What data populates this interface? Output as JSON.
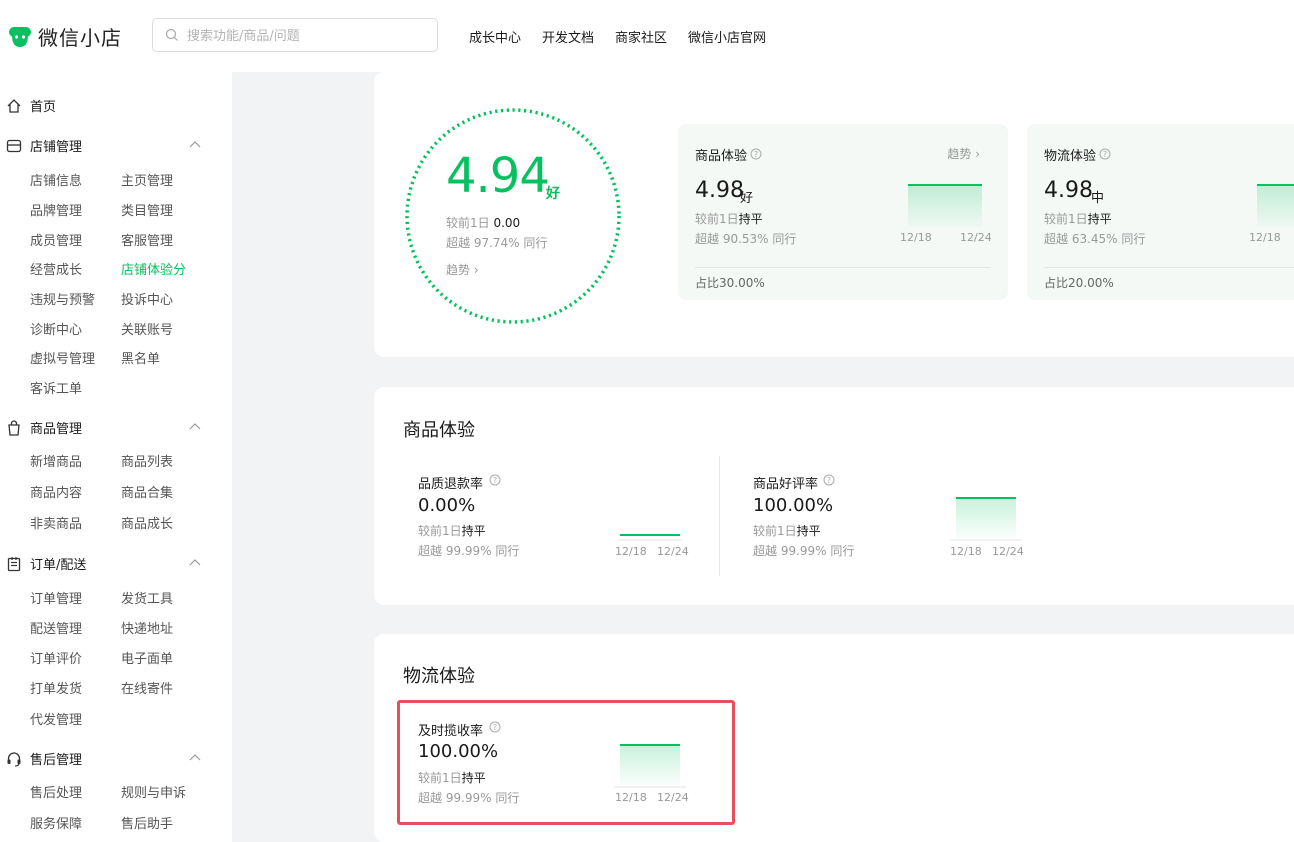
{
  "app": {
    "title": "微信小店"
  },
  "search": {
    "placeholder": "搜索功能/商品/问题"
  },
  "topnav": [
    "成长中心",
    "开发文档",
    "商家社区",
    "微信小店官网"
  ],
  "sidebar": {
    "home": "首页",
    "groups": [
      {
        "label": "店铺管理",
        "items": [
          "店铺信息",
          "主页管理",
          "品牌管理",
          "类目管理",
          "成员管理",
          "客服管理",
          "经营成长",
          "店铺体验分",
          "违规与预警",
          "投诉中心",
          "诊断中心",
          "关联账号",
          "虚拟号管理",
          "黑名单",
          "客诉工单"
        ],
        "active": "店铺体验分"
      },
      {
        "label": "商品管理",
        "items": [
          "新增商品",
          "商品列表",
          "商品内容",
          "商品合集",
          "非卖商品",
          "商品成长"
        ]
      },
      {
        "label": "订单/配送",
        "items": [
          "订单管理",
          "发货工具",
          "配送管理",
          "快递地址",
          "订单评价",
          "电子面单",
          "打单发货",
          "在线寄件",
          "代发管理"
        ]
      },
      {
        "label": "售后管理",
        "items": [
          "售后处理",
          "规则与申诉",
          "服务保障",
          "售后助手"
        ]
      }
    ]
  },
  "overview": {
    "score": "4.94",
    "grade": "好",
    "compare_prefix": "较前1日",
    "compare_value": "0.00",
    "beat_text": "超越 97.74% 同行",
    "trend_label": "趋势",
    "cards": [
      {
        "title": "商品体验",
        "score": "4.98",
        "grade": "好",
        "compare_prefix": "较前1日",
        "compare_value": "持平",
        "beat_text": "超越 90.53% 同行",
        "share_text": "占比30.00%",
        "trend_label": "趋势",
        "ticks": [
          "12/18",
          "12/24"
        ]
      },
      {
        "title": "物流体验",
        "score": "4.98",
        "grade": "中",
        "compare_prefix": "较前1日",
        "compare_value": "持平",
        "beat_text": "超越 63.45% 同行",
        "share_text": "占比20.00%",
        "ticks": [
          "12/18"
        ]
      }
    ]
  },
  "product_section": {
    "title": "商品体验",
    "metrics": [
      {
        "title": "品质退款率",
        "value": "0.00%",
        "compare_prefix": "较前1日",
        "compare_value": "持平",
        "beat_text": "超越 99.99% 同行",
        "ticks": [
          "12/18",
          "12/24"
        ]
      },
      {
        "title": "商品好评率",
        "value": "100.00%",
        "compare_prefix": "较前1日",
        "compare_value": "持平",
        "beat_text": "超越 99.99% 同行",
        "ticks": [
          "12/18",
          "12/24"
        ]
      }
    ]
  },
  "logistics_section": {
    "title": "物流体验",
    "metrics": [
      {
        "title": "及时揽收率",
        "value": "100.00%",
        "compare_prefix": "较前1日",
        "compare_value": "持平",
        "beat_text": "超越 99.99% 同行",
        "ticks": [
          "12/18",
          "12/24"
        ]
      }
    ]
  },
  "colors": {
    "accent": "#07c160",
    "highlight": "#e5515a"
  }
}
